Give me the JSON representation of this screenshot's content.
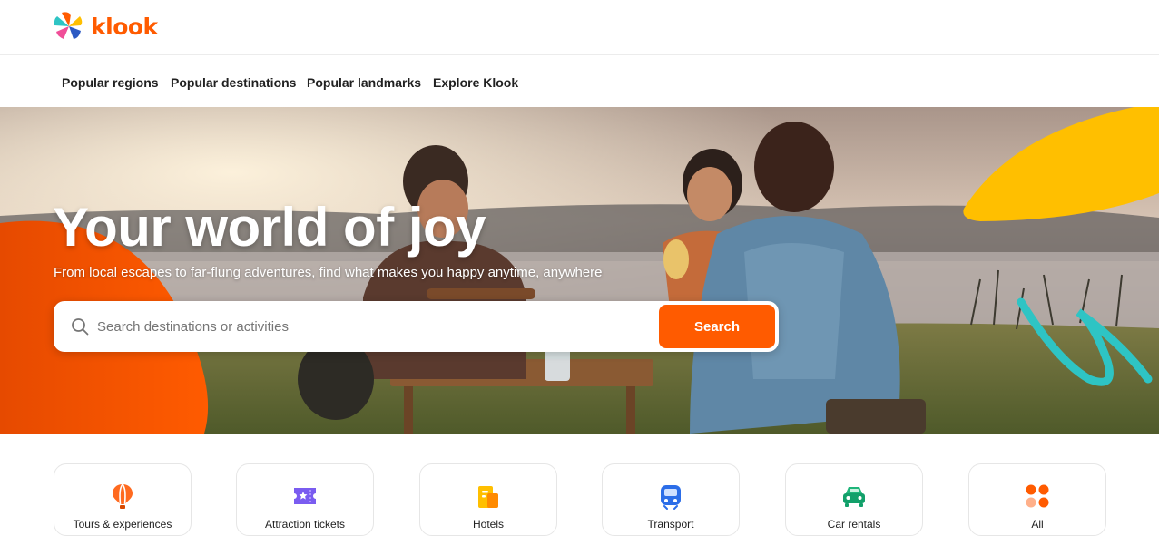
{
  "brand": {
    "name": "klook"
  },
  "nav": {
    "items": [
      {
        "label": "Popular regions"
      },
      {
        "label": "Popular destinations"
      },
      {
        "label": "Popular landmarks"
      },
      {
        "label": "Explore Klook"
      }
    ]
  },
  "hero": {
    "title": "Your world of joy",
    "subtitle": "From local escapes to far-flung adventures, find what makes you happy anytime, anywhere"
  },
  "search": {
    "placeholder": "Search destinations or activities",
    "value": "",
    "button_label": "Search"
  },
  "categories": [
    {
      "label": "Tours & experiences",
      "icon": "hot-air-balloon-icon"
    },
    {
      "label": "Attraction tickets",
      "icon": "ticket-icon"
    },
    {
      "label": "Hotels",
      "icon": "hotel-icon"
    },
    {
      "label": "Transport",
      "icon": "train-icon"
    },
    {
      "label": "Car rentals",
      "icon": "car-icon"
    },
    {
      "label": "All",
      "icon": "grid-icon"
    }
  ],
  "colors": {
    "accent": "#ff5b00",
    "yellow": "#ffbf00",
    "teal": "#2ec4c4"
  }
}
